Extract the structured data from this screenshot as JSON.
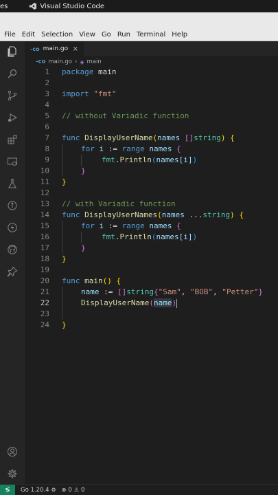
{
  "os_bar": {
    "activities": "es",
    "app_name": "Visual Studio Code"
  },
  "menu": [
    "File",
    "Edit",
    "Selection",
    "View",
    "Go",
    "Run",
    "Terminal",
    "Help"
  ],
  "tab": {
    "file_icon": "-co",
    "label": "main.go",
    "close": "×"
  },
  "breadcrumb": {
    "file_icon": "-co",
    "file": "main.go",
    "sep": "›",
    "symbol": "main"
  },
  "code": {
    "l1": {
      "n": "1",
      "a": "package",
      "b": " main"
    },
    "l2": {
      "n": "2"
    },
    "l3": {
      "n": "3",
      "a": "import",
      "b": "\"fmt\""
    },
    "l4": {
      "n": "4"
    },
    "l5": {
      "n": "5",
      "a": "// without Variadic function"
    },
    "l6": {
      "n": "6"
    },
    "l7": {
      "n": "7",
      "a": "func",
      "b": "DisplayUserName",
      "c": "(",
      "d": "names",
      "e": " []",
      "f": "string",
      "g": ")",
      "h": " {"
    },
    "l8": {
      "n": "8",
      "a": "for",
      "b": " i",
      "c": " := ",
      "d": "range",
      "e": " names",
      "f": " {"
    },
    "l9": {
      "n": "9",
      "a": "fmt",
      "b": ".",
      "c": "Println",
      "d": "(",
      "e": "names",
      "f": "[i]",
      "g": ")"
    },
    "l10": {
      "n": "10",
      "a": "}"
    },
    "l11": {
      "n": "11",
      "a": "}"
    },
    "l12": {
      "n": "12"
    },
    "l13": {
      "n": "13",
      "a": "// with Variadic function"
    },
    "l14": {
      "n": "14",
      "a": "func",
      "b": "DisplayUserNames",
      "c": "(",
      "d": "names",
      "e": " ...",
      "f": "string",
      "g": ")",
      "h": " {"
    },
    "l15": {
      "n": "15",
      "a": "for",
      "b": " i",
      "c": " := ",
      "d": "range",
      "e": " names",
      "f": " {"
    },
    "l16": {
      "n": "16",
      "a": "fmt",
      "b": ".",
      "c": "Println",
      "d": "(",
      "e": "names",
      "f": "[i]",
      "g": ")"
    },
    "l17": {
      "n": "17",
      "a": "}"
    },
    "l18": {
      "n": "18",
      "a": "}"
    },
    "l19": {
      "n": "19"
    },
    "l20": {
      "n": "20",
      "a": "func",
      "b": "main",
      "c": "()",
      "d": " {"
    },
    "l21": {
      "n": "21",
      "a": "name",
      "b": " := ",
      "c": "[]",
      "d": "string",
      "e": "{",
      "f": "\"Sam\"",
      "g": ", ",
      "h": "\"BOB\"",
      "i": ", ",
      "j": "\"Petter\"",
      "k": "}"
    },
    "l22": {
      "n": "22",
      "a": "DisplayUserName",
      "b": "(",
      "c": "name",
      "d": ")"
    },
    "l23": {
      "n": "23"
    },
    "l24": {
      "n": "24",
      "a": "}"
    }
  },
  "status": {
    "remote": "≶",
    "go_version": "Go 1.20.4",
    "errors": "0",
    "warnings": "0"
  },
  "colors": {
    "remote_bg": "#16825d",
    "keyword": "#569cd6",
    "function": "#dcdcaa",
    "string": "#ce9178",
    "comment": "#6a9955",
    "variable": "#9cdcfe"
  }
}
